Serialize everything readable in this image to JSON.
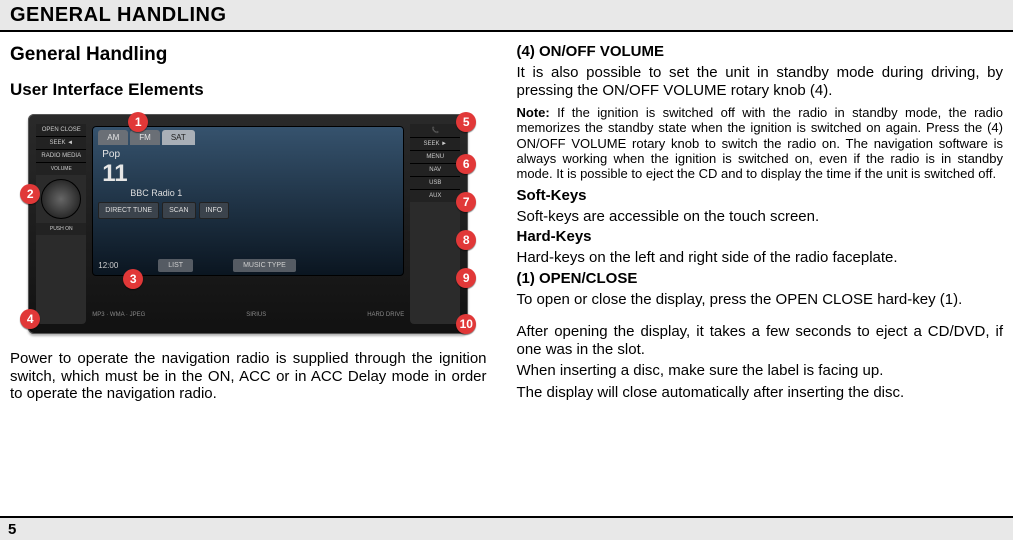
{
  "header": {
    "title": "GENERAL HANDLING"
  },
  "left": {
    "h2": "General Handling",
    "h3": "User Interface Elements",
    "para": "Power to operate the navigation radio is supplied through the ignition switch, which must be in the ON, ACC or in ACC Delay mode in order to operate the navigation radio."
  },
  "device": {
    "tabs": {
      "am": "AM",
      "fm": "FM",
      "sat": "SAT"
    },
    "genre": "Pop",
    "preset": "11",
    "station": "BBC Radio 1",
    "btn_direct": "DIRECT TUNE",
    "btn_scan": "SCAN",
    "btn_info": "INFO",
    "time": "12:00",
    "pill_list": "LIST",
    "pill_music": "MUSIC TYPE",
    "brand": "SIRIUS",
    "codec": "MP3 · WMA · JPEG",
    "drive": "HARD DRIVE",
    "hk_left": [
      "OPEN CLOSE",
      "SEEK ◄",
      "RADIO MEDIA",
      "VOLUME"
    ],
    "hk_right": [
      "📞",
      "SEEK ►",
      "MENU",
      "NAV",
      "USB",
      "AUX"
    ],
    "push": "PUSH ON",
    "markers": [
      "1",
      "2",
      "3",
      "4",
      "5",
      "6",
      "7",
      "8",
      "9",
      "10"
    ]
  },
  "right": {
    "s4_title": "(4) ON/OFF VOLUME",
    "s4_p1": "It is also possible to set the unit in standby mode during driving, by pressing the ON/OFF VOLUME rotary knob (4).",
    "note_label": "Note:",
    "note_body": " If the ignition is switched off with the radio in standby mode, the radio memorizes the standby state when the ignition is switched on again. Press the (4) ON/OFF VOLUME rotary knob to switch the radio on. The navigation software is always working when the ignition is switched on, even if the radio is in standby mode. It is possible to eject the CD and to display the time if the unit is switched off.",
    "soft_h": "Soft-Keys",
    "soft_p": "Soft-keys are accessible on the touch screen.",
    "hard_h": "Hard-Keys",
    "hard_p": "Hard-keys on the left and right side of the radio faceplate.",
    "s1_title": "(1) OPEN/CLOSE",
    "s1_p1": "To open or close the display, press the OPEN CLOSE hard-key (1).",
    "s1_p2": "After opening the display, it takes a few seconds to eject a CD/DVD, if one was in the slot.",
    "s1_p3": "When inserting a disc, make sure the label is facing up.",
    "s1_p4": "The display will close automatically after inserting the disc."
  },
  "footer": {
    "page": "5"
  }
}
